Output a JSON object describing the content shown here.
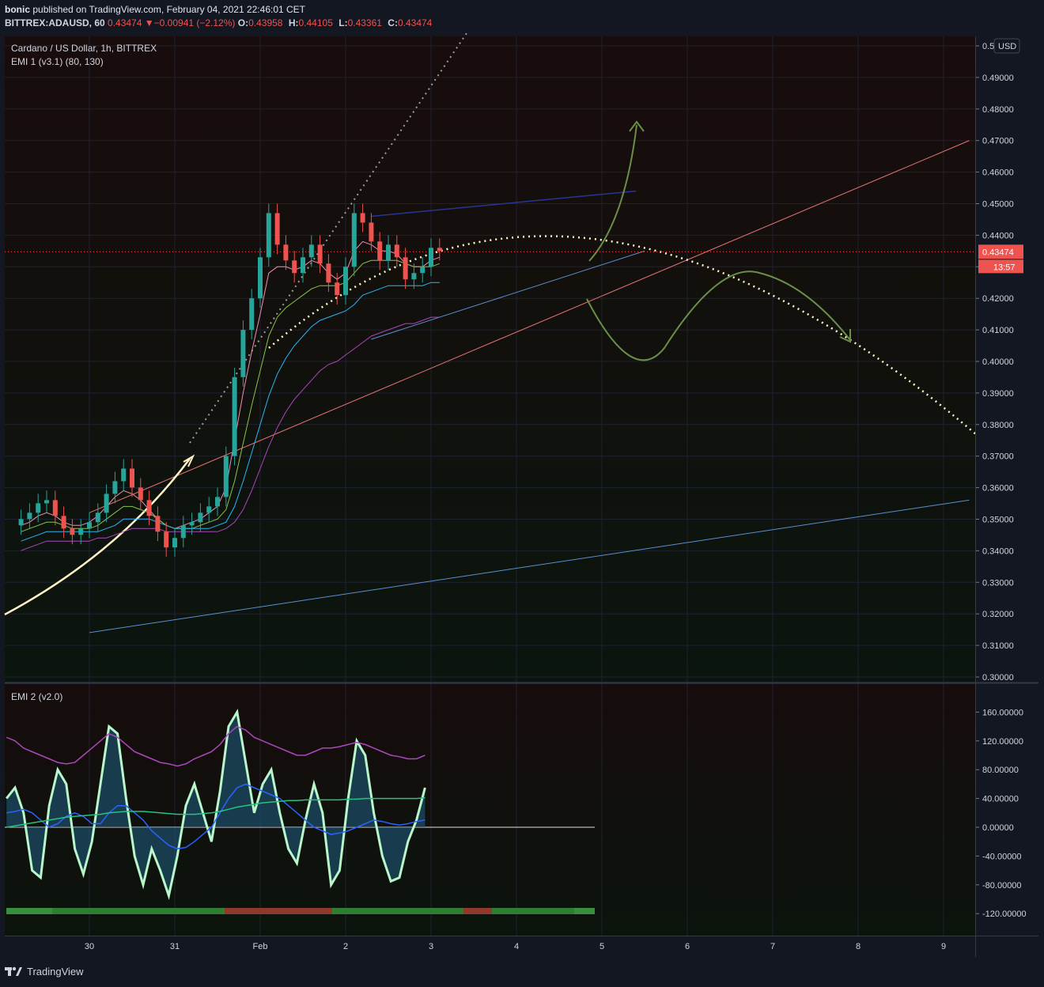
{
  "header": {
    "author": "bonic",
    "published_text": "published on TradingView.com, February 04, 2021 22:46:01 CET",
    "symbol": "BITTREX:ADAUSD, 60",
    "last": "0.43474",
    "change": "−0.00941 (−2.12%)",
    "o_label": "O:",
    "o_value": "0.43958",
    "h_label": "H:",
    "h_value": "0.44105",
    "l_label": "L:",
    "l_value": "0.43361",
    "c_label": "C:",
    "c_value": "0.43474"
  },
  "main_pane": {
    "title": "Cardano / US Dollar, 1h, BITTREX",
    "indicator": "EMI 1 (v3.1) (80, 130)",
    "currency_badge": "USD",
    "price_badge": "0.43474",
    "countdown_badge": "13:57"
  },
  "sub_pane": {
    "title": "EMI 2 (v2.0)"
  },
  "x_axis_labels": [
    "30",
    "31",
    "Feb",
    "2",
    "3",
    "4",
    "5",
    "6",
    "7",
    "8",
    "9"
  ],
  "footer": {
    "brand": "TradingView"
  },
  "colors": {
    "background": "#131722",
    "up": "#26a69a",
    "down": "#ef5350",
    "grid": "#1e2230"
  },
  "chart_data": [
    {
      "type": "candlestick",
      "title": "Cardano / US Dollar, 1h, BITTREX",
      "ylim": [
        0.3,
        0.5
      ],
      "y_ticks": [
        "0.5",
        "0.49000",
        "0.48000",
        "0.47000",
        "0.46000",
        "0.45000",
        "0.44000",
        "0.43000",
        "0.42000",
        "0.41000",
        "0.40000",
        "0.39000",
        "0.38000",
        "0.37000",
        "0.36000",
        "0.35000",
        "0.34000",
        "0.33000",
        "0.32000",
        "0.31000",
        "0.30000"
      ],
      "x_ticks": [
        "30",
        "31",
        "Feb",
        "2",
        "3",
        "4",
        "5",
        "6",
        "7",
        "8",
        "9"
      ],
      "series": [
        {
          "x": [
            0,
            0.1,
            0.2,
            0.3,
            0.4,
            0.5,
            0.6,
            0.7,
            0.8,
            0.9,
            1.0,
            1.1,
            1.2,
            1.3,
            1.4,
            1.5,
            1.6,
            1.7,
            1.8,
            1.9,
            2.0,
            2.1,
            2.2,
            2.3,
            2.4,
            2.5,
            2.6,
            2.7,
            2.8,
            2.9,
            3.0,
            3.1,
            3.2,
            3.3,
            3.4,
            3.5,
            3.6,
            3.7,
            3.8,
            3.9,
            4.0,
            4.1,
            4.2,
            4.3,
            4.4,
            4.5,
            4.6,
            4.7,
            4.8,
            4.9
          ],
          "close": [
            0.35,
            0.352,
            0.355,
            0.356,
            0.351,
            0.347,
            0.345,
            0.347,
            0.349,
            0.352,
            0.358,
            0.362,
            0.366,
            0.36,
            0.356,
            0.351,
            0.346,
            0.341,
            0.344,
            0.348,
            0.349,
            0.352,
            0.354,
            0.357,
            0.37,
            0.395,
            0.41,
            0.42,
            0.433,
            0.447,
            0.437,
            0.432,
            0.428,
            0.433,
            0.437,
            0.431,
            0.425,
            0.421,
            0.43,
            0.447,
            0.444,
            0.438,
            0.432,
            0.437,
            0.433,
            0.426,
            0.428,
            0.43,
            0.436,
            0.435
          ]
        }
      ],
      "lines": [
        {
          "name": "",
          "color": "#f48fb1",
          "values": [
            0.348,
            0.349,
            0.351,
            0.352,
            0.351,
            0.349,
            0.348,
            0.348,
            0.349,
            0.351,
            0.354,
            0.357,
            0.359,
            0.358,
            0.356,
            0.353,
            0.35,
            0.348,
            0.347,
            0.348,
            0.349,
            0.35,
            0.352,
            0.354,
            0.36,
            0.375,
            0.39,
            0.403,
            0.415,
            0.428,
            0.43,
            0.43,
            0.429,
            0.43,
            0.432,
            0.431,
            0.428,
            0.426,
            0.428,
            0.435,
            0.438,
            0.437,
            0.435,
            0.435,
            0.434,
            0.431,
            0.43,
            0.43,
            0.432,
            0.433
          ]
        },
        {
          "name": "",
          "color": "#8bc34a",
          "values": [
            0.346,
            0.347,
            0.348,
            0.349,
            0.349,
            0.348,
            0.347,
            0.347,
            0.347,
            0.348,
            0.35,
            0.352,
            0.354,
            0.354,
            0.353,
            0.352,
            0.35,
            0.348,
            0.347,
            0.347,
            0.347,
            0.348,
            0.349,
            0.35,
            0.353,
            0.362,
            0.374,
            0.386,
            0.397,
            0.408,
            0.414,
            0.417,
            0.419,
            0.421,
            0.423,
            0.424,
            0.424,
            0.424,
            0.425,
            0.428,
            0.431,
            0.432,
            0.432,
            0.432,
            0.432,
            0.431,
            0.43,
            0.43,
            0.43,
            0.431
          ]
        },
        {
          "name": "",
          "color": "#29b6f6",
          "values": [
            0.343,
            0.344,
            0.345,
            0.346,
            0.346,
            0.346,
            0.346,
            0.346,
            0.346,
            0.346,
            0.347,
            0.348,
            0.35,
            0.35,
            0.35,
            0.35,
            0.349,
            0.348,
            0.347,
            0.347,
            0.347,
            0.347,
            0.347,
            0.348,
            0.349,
            0.354,
            0.362,
            0.371,
            0.38,
            0.389,
            0.396,
            0.401,
            0.405,
            0.408,
            0.411,
            0.413,
            0.414,
            0.415,
            0.416,
            0.418,
            0.421,
            0.422,
            0.423,
            0.424,
            0.424,
            0.424,
            0.424,
            0.424,
            0.425,
            0.425
          ]
        },
        {
          "name": "",
          "color": "#ab47bc",
          "values": [
            0.34,
            0.341,
            0.342,
            0.343,
            0.343,
            0.343,
            0.343,
            0.343,
            0.343,
            0.344,
            0.344,
            0.345,
            0.346,
            0.347,
            0.347,
            0.347,
            0.347,
            0.346,
            0.346,
            0.346,
            0.346,
            0.346,
            0.346,
            0.346,
            0.347,
            0.349,
            0.353,
            0.359,
            0.366,
            0.373,
            0.379,
            0.384,
            0.388,
            0.391,
            0.394,
            0.397,
            0.399,
            0.4,
            0.402,
            0.404,
            0.406,
            0.408,
            0.409,
            0.41,
            0.411,
            0.412,
            0.412,
            0.413,
            0.414,
            0.414
          ]
        }
      ],
      "last_price": 0.43474,
      "annotations": {
        "resistance_upper": {
          "from": [
            0,
            0.352
          ],
          "to": [
            10.3,
            0.47
          ]
        },
        "channel_top": {
          "from": [
            3.3,
            0.446
          ],
          "to": [
            6.4,
            0.454
          ]
        },
        "channel_mid": {
          "from": [
            3.3,
            0.407
          ],
          "to": [
            6.5,
            0.435
          ]
        },
        "support_lower": {
          "from": [
            0,
            0.314
          ],
          "to": [
            10.3,
            0.356
          ]
        }
      }
    },
    {
      "type": "line",
      "title": "EMI 2 (v2.0)",
      "ylim": [
        -130,
        190
      ],
      "y_ticks": [
        "160.00000",
        "120.00000",
        "80.00000",
        "40.00000",
        "0.00000",
        "-40.00000",
        "-80.00000",
        "-120.00000"
      ],
      "series": [
        {
          "name": "",
          "color": "#b9f6ca",
          "values": [
            40,
            55,
            20,
            -60,
            -70,
            30,
            80,
            60,
            -30,
            -65,
            -20,
            60,
            140,
            130,
            40,
            -40,
            -80,
            -30,
            -60,
            -95,
            -40,
            30,
            60,
            20,
            -20,
            50,
            140,
            160,
            90,
            20,
            60,
            80,
            20,
            -30,
            -50,
            10,
            60,
            20,
            -80,
            -60,
            40,
            120,
            100,
            20,
            -40,
            -75,
            -70,
            -20,
            10,
            55
          ]
        },
        {
          "name": "",
          "color": "#ab47bc",
          "values": [
            125,
            120,
            110,
            105,
            100,
            95,
            90,
            88,
            90,
            100,
            110,
            120,
            130,
            125,
            115,
            105,
            100,
            95,
            90,
            88,
            85,
            88,
            95,
            100,
            105,
            115,
            130,
            140,
            135,
            125,
            120,
            115,
            110,
            105,
            100,
            100,
            105,
            110,
            110,
            112,
            115,
            118,
            115,
            110,
            105,
            100,
            98,
            95,
            95,
            100
          ]
        },
        {
          "name": "",
          "color": "#2962ff",
          "values": [
            20,
            22,
            25,
            20,
            10,
            0,
            5,
            15,
            20,
            15,
            5,
            5,
            20,
            30,
            30,
            20,
            10,
            -5,
            -15,
            -25,
            -30,
            -28,
            -20,
            -10,
            0,
            20,
            40,
            55,
            60,
            55,
            50,
            45,
            40,
            30,
            20,
            10,
            0,
            -5,
            -10,
            -8,
            -5,
            0,
            5,
            10,
            8,
            5,
            3,
            5,
            8,
            10
          ]
        },
        {
          "name": "",
          "color": "#26c281",
          "values": [
            0,
            2,
            4,
            6,
            8,
            10,
            12,
            14,
            15,
            16,
            17,
            18,
            20,
            21,
            22,
            22,
            22,
            21,
            20,
            19,
            18,
            18,
            18,
            19,
            20,
            22,
            25,
            28,
            30,
            32,
            34,
            35,
            36,
            37,
            37,
            38,
            38,
            38,
            38,
            38,
            39,
            39,
            40,
            40,
            40,
            40,
            40,
            40,
            40,
            41
          ]
        }
      ]
    }
  ]
}
